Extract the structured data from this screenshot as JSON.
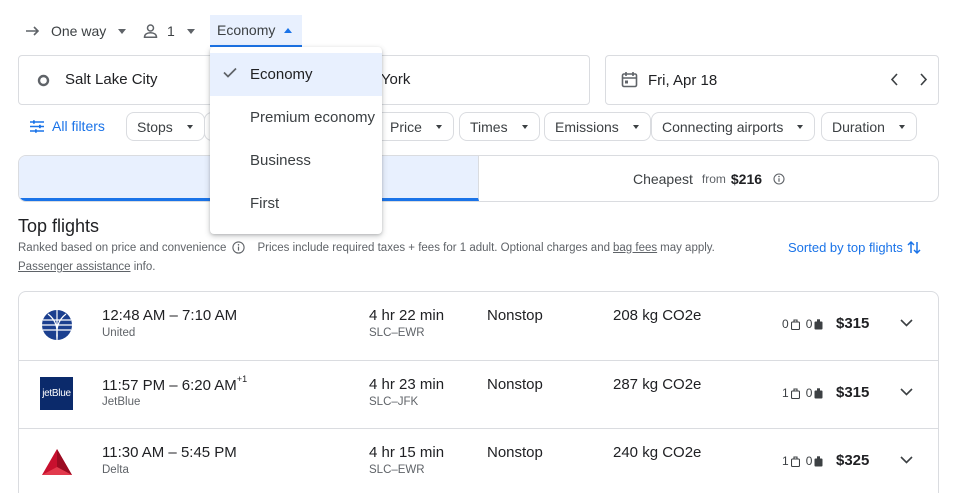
{
  "search": {
    "trip_type": "One way",
    "passengers": "1",
    "seat_class": "Economy",
    "origin": "Salt Lake City",
    "destination": "New York",
    "date": "Fri, Apr 18"
  },
  "filters": {
    "all_filters": "All filters",
    "chips": [
      "Stops",
      "Price",
      "Times",
      "Emissions",
      "Connecting airports",
      "Duration"
    ]
  },
  "sort_tabs": {
    "cheapest_label": "Cheapest",
    "cheapest_from": "from",
    "cheapest_price": "$216"
  },
  "results": {
    "title": "Top flights",
    "ranked_text": "Ranked based on price and convenience",
    "prices_text_pre": "Prices include required taxes + fees for 1 adult. Optional charges and",
    "bag_fees_link": "bag fees",
    "prices_text_post": "may apply.",
    "passenger_link": "Passenger assistance",
    "info_text": "info.",
    "sort_label": "Sorted by top flights"
  },
  "flights": [
    {
      "times": "12:48 AM – 7:10 AM",
      "day_offset": "",
      "airline": "United",
      "duration": "4 hr 22 min",
      "route": "SLC–EWR",
      "stops": "Nonstop",
      "emissions": "208 kg CO2e",
      "carry_on": "0",
      "checked": "0",
      "price": "$315"
    },
    {
      "times": "11:57 PM – 6:20 AM",
      "day_offset": "+1",
      "airline": "JetBlue",
      "duration": "4 hr 23 min",
      "route": "SLC–JFK",
      "stops": "Nonstop",
      "emissions": "287 kg CO2e",
      "carry_on": "1",
      "checked": "0",
      "price": "$315"
    },
    {
      "times": "11:30 AM – 5:45 PM",
      "day_offset": "",
      "airline": "Delta",
      "duration": "4 hr 15 min",
      "route": "SLC–EWR",
      "stops": "Nonstop",
      "emissions": "240 kg CO2e",
      "carry_on": "1",
      "checked": "0",
      "price": "$325"
    }
  ],
  "logos": {
    "jetblue_text": "jetBlue"
  },
  "menu": {
    "items": [
      "Economy",
      "Premium economy",
      "Business",
      "First"
    ],
    "selected": "Economy"
  },
  "colors": {
    "accent": "#1a73e8",
    "selected_bg": "#e8f0fe",
    "border": "#dadce0",
    "united": "#1b3f8f",
    "jetblue": "#0b2a6b",
    "delta": "#c8102e"
  }
}
